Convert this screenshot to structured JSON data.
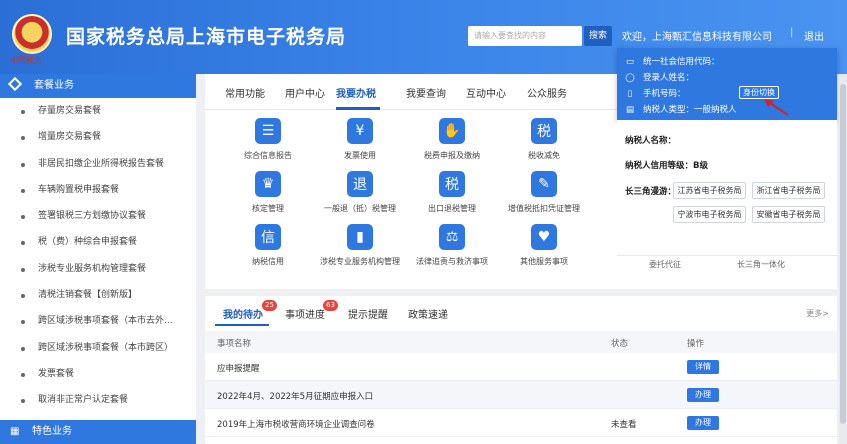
{
  "header": {
    "title": "国家税务总局上海市电子税务局",
    "emblem_caption": "中国税务",
    "search_placeholder": "请输入要查找的内容",
    "search_label": "搜索",
    "welcome": "欢迎，上海甄汇信息科技有限公司",
    "separator": "|",
    "logout": "退出"
  },
  "sidebar": {
    "header": "套餐业务",
    "items": [
      {
        "label": "存量房交易套餐"
      },
      {
        "label": "增量房交易套餐"
      },
      {
        "label": "非居民扣缴企业所得税报告套餐"
      },
      {
        "label": "车辆购置税申报套餐"
      },
      {
        "label": "签署银税三方划缴协议套餐"
      },
      {
        "label": "税（费）种综合申报套餐"
      },
      {
        "label": "涉税专业服务机构管理套餐"
      },
      {
        "label": "清税注销套餐【创新版】"
      },
      {
        "label": "跨区域涉税事项套餐（本市去外..."
      },
      {
        "label": "跨区域涉税事项套餐（本市跨区）"
      },
      {
        "label": "发票套餐"
      },
      {
        "label": "取消非正常户认定套餐"
      }
    ],
    "footer": "特色业务"
  },
  "tabs": [
    {
      "label": "常用功能"
    },
    {
      "label": "用户中心"
    },
    {
      "label": "我要办税"
    },
    {
      "label": "我要查询"
    },
    {
      "label": "互动中心"
    },
    {
      "label": "公众服务"
    }
  ],
  "functions": [
    {
      "label": "综合信息报告",
      "icon": "report-icon",
      "color": "#2f78e0",
      "glyph": "☰"
    },
    {
      "label": "发票使用",
      "icon": "invoice-icon",
      "color": "#2f78e0",
      "glyph": "¥"
    },
    {
      "label": "税费申报及缴纳",
      "icon": "tax-pay-icon",
      "color": "#2f78e0",
      "glyph": "✋"
    },
    {
      "label": "税收减免",
      "icon": "tax-reduce-icon",
      "color": "#2f78e0",
      "glyph": "税"
    },
    {
      "label": "核定管理",
      "icon": "approve-icon",
      "color": "#2f78e0",
      "glyph": "♛"
    },
    {
      "label": "一般退（抵）税管理",
      "icon": "refund-icon",
      "color": "#2f78e0",
      "glyph": "退"
    },
    {
      "label": "出口退税管理",
      "icon": "export-refund-icon",
      "color": "#2f78e0",
      "glyph": "税"
    },
    {
      "label": "增值税抵扣凭证管理",
      "icon": "vat-voucher-icon",
      "color": "#2f78e0",
      "glyph": "✎"
    },
    {
      "label": "纳税信用",
      "icon": "credit-icon",
      "color": "#2f78e0",
      "glyph": "信"
    },
    {
      "label": "涉税专业服务机构管理",
      "icon": "agency-icon",
      "color": "#2f78e0",
      "glyph": "▮"
    },
    {
      "label": "法律追责与救济事项",
      "icon": "law-icon",
      "color": "#2f78e0",
      "glyph": "⚖"
    },
    {
      "label": "其他服务事项",
      "icon": "other-service-icon",
      "color": "#2f78e0",
      "glyph": "♥"
    }
  ],
  "panel": {
    "credit_code_label": "统一社会信用代码：",
    "login_name_label": "登录人姓名：",
    "phone_label": "手机号码：",
    "switch_label": "身份切换",
    "taxpayer_type": "纳税人类型：一般纳税人"
  },
  "info": {
    "taxpayer_name_label": "纳税人名称：",
    "credit_level": "纳税人信用等级：B级",
    "yrd_label": "长三角漫游：",
    "yrd_tags": [
      "江苏省电子税务局",
      "浙江省电子税务局",
      "宁波市电子税务局",
      "安徽省电子税务局"
    ]
  },
  "right_below": {
    "left": "委托代征",
    "right": "长三角一体化"
  },
  "tasks": {
    "tabs": [
      {
        "label": "我的待办",
        "badge": "25"
      },
      {
        "label": "事项进度",
        "badge": "63"
      },
      {
        "label": "提示提醒"
      },
      {
        "label": "政策速递"
      }
    ],
    "more": "更多>",
    "columns": {
      "name": "事项名称",
      "status": "状态",
      "action": "操作"
    },
    "rows": [
      {
        "name": "应申报提醒",
        "status": "",
        "action": "详情"
      },
      {
        "name": "2022年4月、2022年5月征期应申报入口",
        "status": "",
        "action": "办理"
      },
      {
        "name": "2019年上海市税收营商环境企业调查问卷",
        "status": "未查看",
        "action": "办理"
      }
    ]
  },
  "colors": {
    "brand": "#2f78e0",
    "dark": "#1f5fbf",
    "badge": "#e8433e"
  }
}
